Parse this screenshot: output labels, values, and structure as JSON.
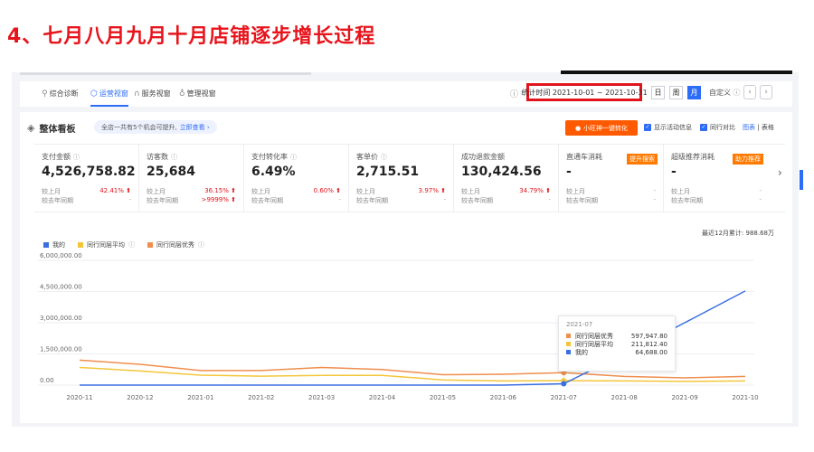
{
  "heading": "4、七月八月九月十月店铺逐步增长过程",
  "nav": {
    "tabs": [
      {
        "label": "综合诊断",
        "active": false
      },
      {
        "label": "运营视窗",
        "active": true
      },
      {
        "label": "服务视窗",
        "active": false
      },
      {
        "label": "管理视窗",
        "active": false
      }
    ],
    "date_range": "统计时间 2021-10-01 ~ 2021-10-31",
    "periods": [
      "日",
      "周",
      "月"
    ],
    "active_period": "月",
    "custom": "自定义",
    "prev": "‹",
    "next": "›"
  },
  "panel": {
    "title": "整体看板",
    "tip_text": "全店一共有5个机会可提升,",
    "tip_link": "立即查看 ›",
    "orange_button": "小旺神一键转化",
    "check_activity": "显示活动信息",
    "check_peer": "同行对比",
    "view_chart": "图表",
    "view_sep": "|",
    "view_table": "表格"
  },
  "metrics": [
    {
      "label": "支付金额",
      "value": "4,526,758.82",
      "row1_label": "较上月",
      "row1_value": "42.41% ⬆",
      "row2_label": "较去年同期",
      "row2_value": "-",
      "tag": ""
    },
    {
      "label": "访客数",
      "value": "25,684",
      "row1_label": "较上月",
      "row1_value": "36.15% ⬆",
      "row2_label": "较去年同期",
      "row2_value": ">9999% ⬆",
      "tag": ""
    },
    {
      "label": "支付转化率",
      "value": "6.49%",
      "row1_label": "较上月",
      "row1_value": "0.60% ⬆",
      "row2_label": "较去年同期",
      "row2_value": "-",
      "tag": ""
    },
    {
      "label": "客单价",
      "value": "2,715.51",
      "row1_label": "较上月",
      "row1_value": "3.97% ⬆",
      "row2_label": "较去年同期",
      "row2_value": "-",
      "tag": ""
    },
    {
      "label": "成功退款金额",
      "value": "130,424.56",
      "row1_label": "较上月",
      "row1_value": "34.79% ⬆",
      "row2_label": "较去年同期",
      "row2_value": "-",
      "tag": ""
    },
    {
      "label": "直通车消耗",
      "value": "-",
      "row1_label": "较上月",
      "row1_value": "-",
      "row2_label": "较去年同期",
      "row2_value": "-",
      "tag": "提升搜索"
    },
    {
      "label": "超级推荐消耗",
      "value": "-",
      "row1_label": "较上月",
      "row1_value": "-",
      "row2_label": "较去年同期",
      "row2_value": "-",
      "tag": "助力推荐"
    }
  ],
  "ytd_total": "最近12月累计: 988.68万",
  "colors": {
    "mine": "#3a6fe0",
    "avg": "#f3c63a",
    "excellent": "#f08e4e",
    "accent": "#2d6cf6",
    "alert": "#e1141c"
  },
  "chart_data": {
    "type": "line",
    "categories": [
      "2020-11",
      "2020-12",
      "2021-01",
      "2021-02",
      "2021-03",
      "2021-04",
      "2021-05",
      "2021-06",
      "2021-07",
      "2021-08",
      "2021-09",
      "2021-10"
    ],
    "ylim": [
      0,
      6000000
    ],
    "yticks": [
      "0.00",
      "1,500,000.00",
      "3,000,000.00",
      "4,500,000.00",
      "6,000,000.00"
    ],
    "series": [
      {
        "name": "我的",
        "color": "#3a6fe0",
        "values": [
          0,
          0,
          0,
          0,
          0,
          0,
          0,
          0,
          64688,
          1500000,
          3000000,
          4526758.82
        ]
      },
      {
        "name": "同行同层平均",
        "color": "#f3c63a",
        "values": [
          850000,
          680000,
          480000,
          430000,
          470000,
          470000,
          250000,
          200000,
          211812.4,
          200000,
          180000,
          200000
        ]
      },
      {
        "name": "同行同层优秀",
        "color": "#f08e4e",
        "values": [
          1200000,
          1000000,
          700000,
          700000,
          850000,
          750000,
          500000,
          520000,
          597947.8,
          420000,
          350000,
          420000
        ]
      }
    ],
    "tooltip": {
      "title": "2021-07",
      "rows": [
        {
          "name": "同行同层优秀",
          "value": "597,947.80",
          "color": "#f08e4e"
        },
        {
          "name": "同行同层平均",
          "value": "211,812.40",
          "color": "#f3c63a"
        },
        {
          "name": "我的",
          "value": "64,688.00",
          "color": "#3a6fe0"
        }
      ]
    }
  }
}
